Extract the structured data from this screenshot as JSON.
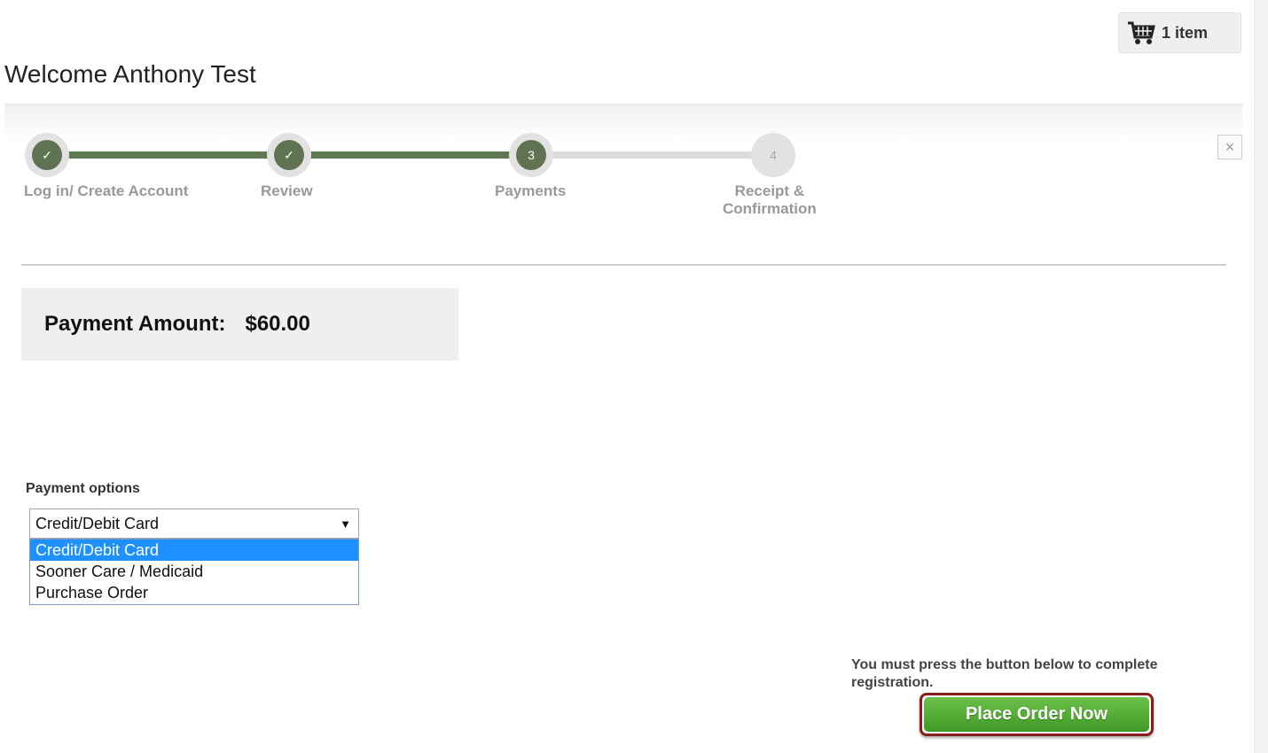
{
  "cart": {
    "label": "1 item",
    "icon": "shopping-cart-icon"
  },
  "header": {
    "welcome": "Welcome Anthony Test"
  },
  "wizard": {
    "steps": [
      {
        "label": "Log in/ Create Account",
        "marker": "✓",
        "state": "done"
      },
      {
        "label": "Review",
        "marker": "✓",
        "state": "done"
      },
      {
        "label": "Payments",
        "marker": "3",
        "state": "current"
      },
      {
        "label_line1": "Receipt &",
        "label_line2": "Confirmation",
        "marker": "4",
        "state": "pending"
      }
    ],
    "close_icon": "×"
  },
  "payment": {
    "amount_label": "Payment Amount:",
    "amount_value": "$60.00"
  },
  "options": {
    "label": "Payment options",
    "selected": "Credit/Debit Card",
    "arrow": "▼",
    "items": [
      "Credit/Debit Card",
      "Sooner Care / Medicaid",
      "Purchase Order"
    ]
  },
  "order": {
    "notice": "You must press the button below to complete registration.",
    "button_label": "Place Order Now"
  },
  "colors": {
    "step_done": "#5f7352",
    "button_green": "#4fae30",
    "button_border": "#8b1c1c",
    "option_highlight": "#1e90ff"
  }
}
